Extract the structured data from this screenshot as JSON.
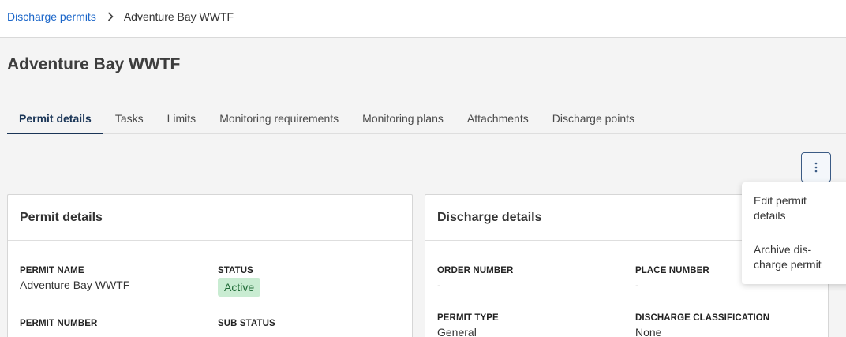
{
  "breadcrumb": {
    "parent": "Discharge permits",
    "current": "Adventure Bay WWTF"
  },
  "page_title": "Adventure Bay WWTF",
  "tabs": [
    {
      "label": "Permit details",
      "active": true
    },
    {
      "label": "Tasks",
      "active": false
    },
    {
      "label": "Limits",
      "active": false
    },
    {
      "label": "Monitoring requirements",
      "active": false
    },
    {
      "label": "Monitoring plans",
      "active": false
    },
    {
      "label": "Attachments",
      "active": false
    },
    {
      "label": "Discharge points",
      "active": false
    }
  ],
  "icons": {
    "chevron": "chevron-right-icon",
    "more": "more-vertical-icon"
  },
  "permit_card": {
    "title": "Permit details",
    "permit_name_label": "PERMIT NAME",
    "permit_name_value": "Adventure Bay WWTF",
    "status_label": "STATUS",
    "status_value": "Active",
    "permit_number_label": "PERMIT NUMBER",
    "sub_status_label": "SUB STATUS"
  },
  "discharge_card": {
    "title": "Discharge details",
    "order_number_label": "ORDER NUMBER",
    "order_number_value": "-",
    "place_number_label": "PLACE NUMBER",
    "place_number_value": "-",
    "permit_type_label": "PERMIT TYPE",
    "permit_type_value": "General",
    "discharge_classification_label": "DISCHARGE CLASSIFICATION",
    "discharge_classification_value": "None"
  },
  "menu": {
    "edit": "Edit permit details",
    "archive": "Archive dis- charge permit"
  },
  "colors": {
    "link": "#1b66c9",
    "active_tab": "#1a3557",
    "badge_bg": "#c9ecd2",
    "badge_text": "#1f6a36"
  }
}
